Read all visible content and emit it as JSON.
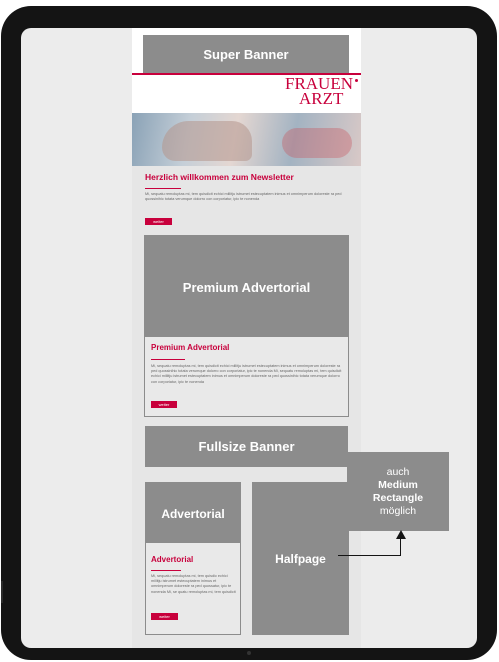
{
  "layout_labels": {
    "super_banner": "Super Banner",
    "premium_advertorial": "Premium Advertorial",
    "fullsize_banner": "Fullsize Banner",
    "advertorial": "Advertorial",
    "halfpage": "Halfpage"
  },
  "brand": {
    "logo_line1": "FRAUEN",
    "logo_line2": "ARZT",
    "accent_color": "#c8003c",
    "placeholder_color": "#8c8c8c"
  },
  "welcome": {
    "title": "Herzlich willkommen zum Newsletter",
    "body": "Mi, sequatu remoluptas mi, tem quisdicit echici millitju istrumet estecuptatem inimus et omnimperum doloreste ra ped quossinihic totata verumque dolorro con corporiatur, ipic te nonenda",
    "button": "weiter"
  },
  "premium_card": {
    "title": "Premium Advertorial",
    "body": "Mi, sequatu remoluptas mi, tem quisdicit echici millitju istrumet estecuptatem inimus et omnimperum doloreste ra ped quossinihic totata verumque dolorro con corporiatur, ipic te nonenda Mi, sequatu remoluptas mi, tem quisdicit echici millitju istrumet estecuptatem inimus et omnimperum doloreste ra ped quossinihic totata verumque dolorro con corporiatur, ipic te nonenda",
    "button": "weiter"
  },
  "advertorial_card": {
    "title": "Advertorial",
    "body": "Mi, sequatu remoluptas mi, tem quisdic echici millitju istrumet estecuptatem inimus et omnimperum doloreste ra ped quossatur, ipic te nonenda Mi, se quatu remoluptas mi, tem quisdicit",
    "button": "weiter"
  },
  "side_note": {
    "line1": "auch",
    "line2": "Medium",
    "line3": "Rectangle",
    "line4": "möglich"
  }
}
